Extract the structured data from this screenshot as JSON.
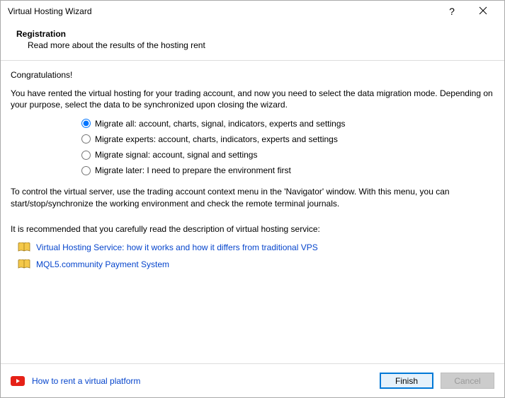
{
  "window": {
    "title": "Virtual Hosting Wizard"
  },
  "header": {
    "heading": "Registration",
    "subheading": "Read more about the results of the hosting rent"
  },
  "content": {
    "congrats": "Congratulations!",
    "intro": "You have rented the virtual hosting for your trading account, and now you need to select the data migration mode. Depending on your purpose, select the data to be synchronized upon closing the wizard.",
    "options": [
      "Migrate all: account, charts, signal, indicators, experts and settings",
      "Migrate experts: account, charts, indicators, experts and settings",
      "Migrate signal: account, signal and settings",
      "Migrate later: I need to prepare the environment first"
    ],
    "selectedOption": 0,
    "control_hint": "To control the virtual server, use the trading account context menu in the 'Navigator' window. With this menu, you can start/stop/synchronize the working environment and check the remote terminal journals.",
    "recommend": "It is recommended that you carefully read the description of virtual hosting service:",
    "links": [
      "Virtual Hosting Service: how it works and how it differs from traditional VPS",
      "MQL5.community Payment System"
    ]
  },
  "footer": {
    "video_link": "How to rent a virtual platform",
    "finish": "Finish",
    "cancel": "Cancel"
  }
}
